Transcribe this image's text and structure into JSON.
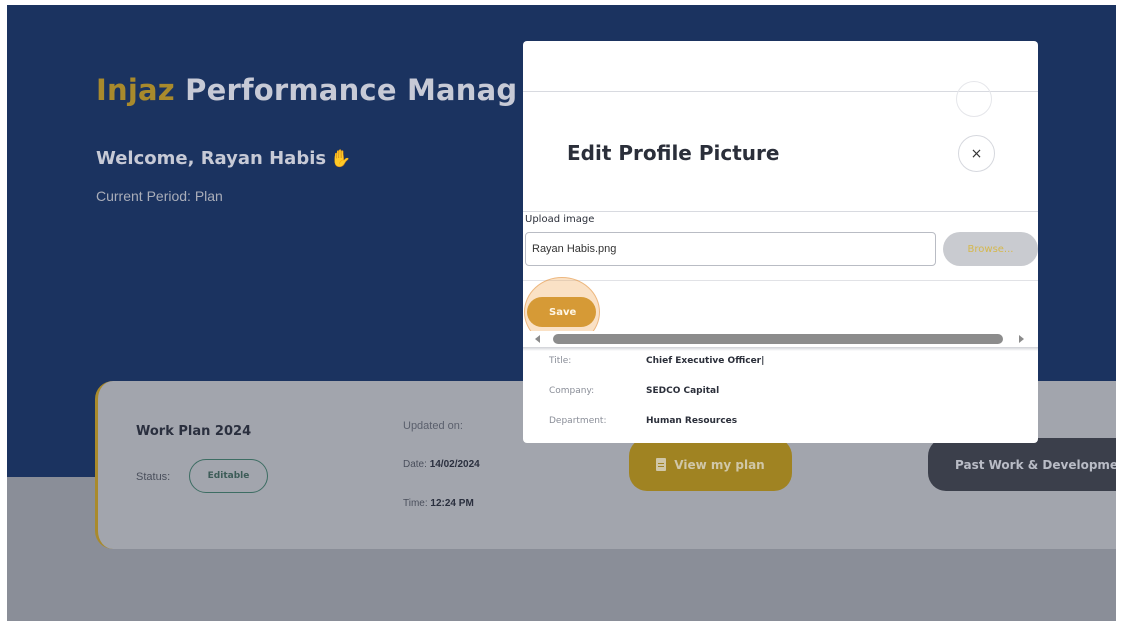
{
  "page": {
    "app_title_brand": "Injaz",
    "app_title_rest": "Performance Manag",
    "welcome": "Welcome, Rayan Habis",
    "period": "Current Period: Plan"
  },
  "plan_card": {
    "name": "Work Plan 2024",
    "status_label": "Status:",
    "status_value": "Editable",
    "updated_label": "Updated on:",
    "date_label": "Date:",
    "date_value": "14/02/2024",
    "time_label": "Time:",
    "time_value": "12:24 PM",
    "view_plan_label": "View my plan",
    "past_work_label": "Past Work & Developmen"
  },
  "modal": {
    "title": "Edit Profile Picture",
    "close_glyph": "×",
    "upload_label": "Upload image",
    "file_value": "Rayan Habis.png",
    "browse_label": "Browse...",
    "save_label": "Save",
    "info": [
      {
        "key": "Title:",
        "value": "Chief Executive Officer|"
      },
      {
        "key": "Company:",
        "value": "SEDCO Capital"
      },
      {
        "key": "Department:",
        "value": "Human Resources"
      }
    ]
  },
  "icons": {
    "wave": "waving-hand-icon",
    "doc": "document-icon",
    "close": "close-icon"
  },
  "colors": {
    "hero_bg": "#1b3360",
    "brand_gold": "#a98a2c",
    "save_orange": "#d69a36",
    "status_green": "#3d6d63",
    "dark_button": "#3b3f4b"
  }
}
